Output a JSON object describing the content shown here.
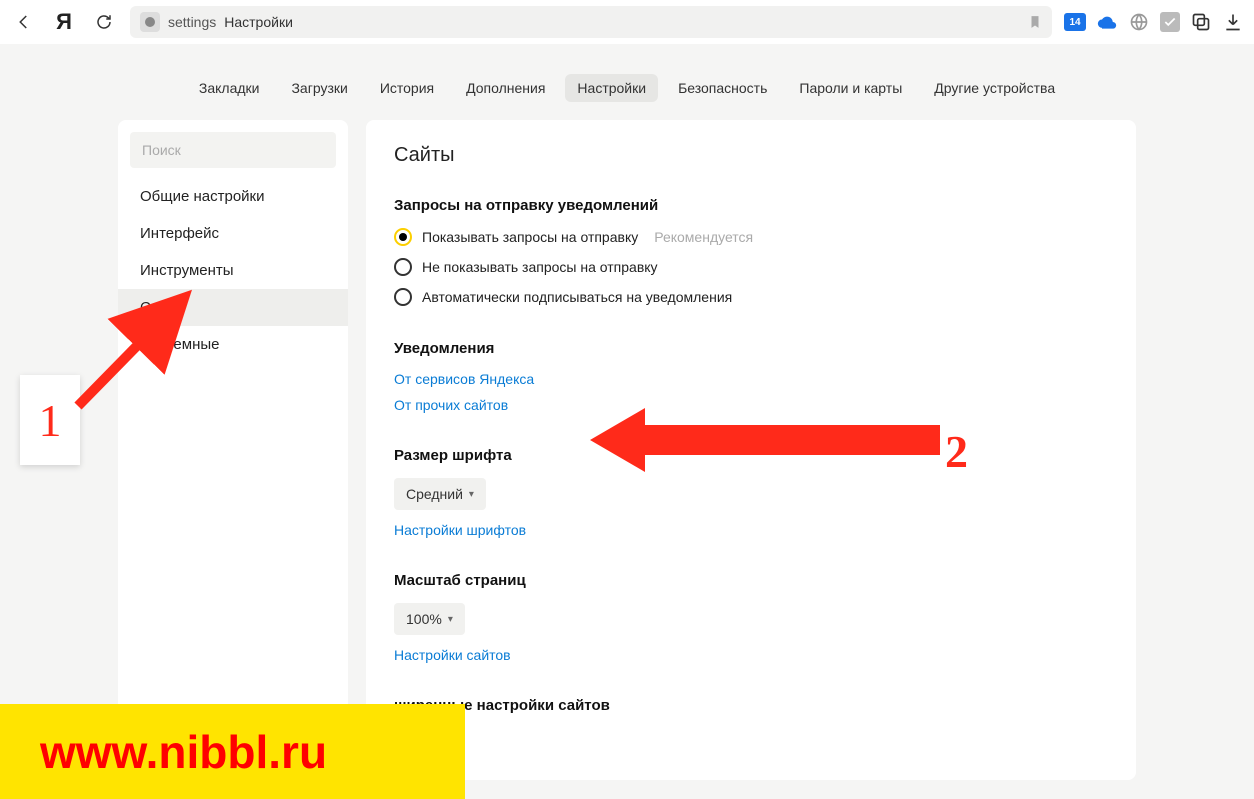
{
  "toolbar": {
    "yandex_letter": "Я",
    "address_settings": "settings",
    "address_title": "Настройки",
    "ext_badge": "14"
  },
  "tabs": [
    {
      "label": "Закладки",
      "active": false
    },
    {
      "label": "Загрузки",
      "active": false
    },
    {
      "label": "История",
      "active": false
    },
    {
      "label": "Дополнения",
      "active": false
    },
    {
      "label": "Настройки",
      "active": true
    },
    {
      "label": "Безопасность",
      "active": false
    },
    {
      "label": "Пароли и карты",
      "active": false
    },
    {
      "label": "Другие устройства",
      "active": false
    }
  ],
  "sidebar": {
    "search_placeholder": "Поиск",
    "items": [
      {
        "label": "Общие настройки",
        "active": false
      },
      {
        "label": "Интерфейс",
        "active": false
      },
      {
        "label": "Инструменты",
        "active": false
      },
      {
        "label": "Сайты",
        "active": true
      },
      {
        "label": "Системные",
        "active": false
      }
    ]
  },
  "main": {
    "title": "Сайты",
    "notif_req": {
      "heading": "Запросы на отправку уведомлений",
      "opt1": "Показывать запросы на отправку",
      "opt1_hint": "Рекомендуется",
      "opt2": "Не показывать запросы на отправку",
      "opt3": "Автоматически подписываться на уведомления"
    },
    "notif": {
      "heading": "Уведомления",
      "link1": "От сервисов Яндекса",
      "link2": "От прочих сайтов"
    },
    "font": {
      "heading": "Размер шрифта",
      "value": "Средний",
      "link": "Настройки шрифтов"
    },
    "zoom": {
      "heading": "Масштаб страниц",
      "value": "100%",
      "link": "Настройки сайтов"
    },
    "advanced_partial": "ширенные настройки сайтов"
  },
  "annotations": {
    "label1": "1",
    "label2": "2",
    "watermark": "www.nibbl.ru"
  }
}
